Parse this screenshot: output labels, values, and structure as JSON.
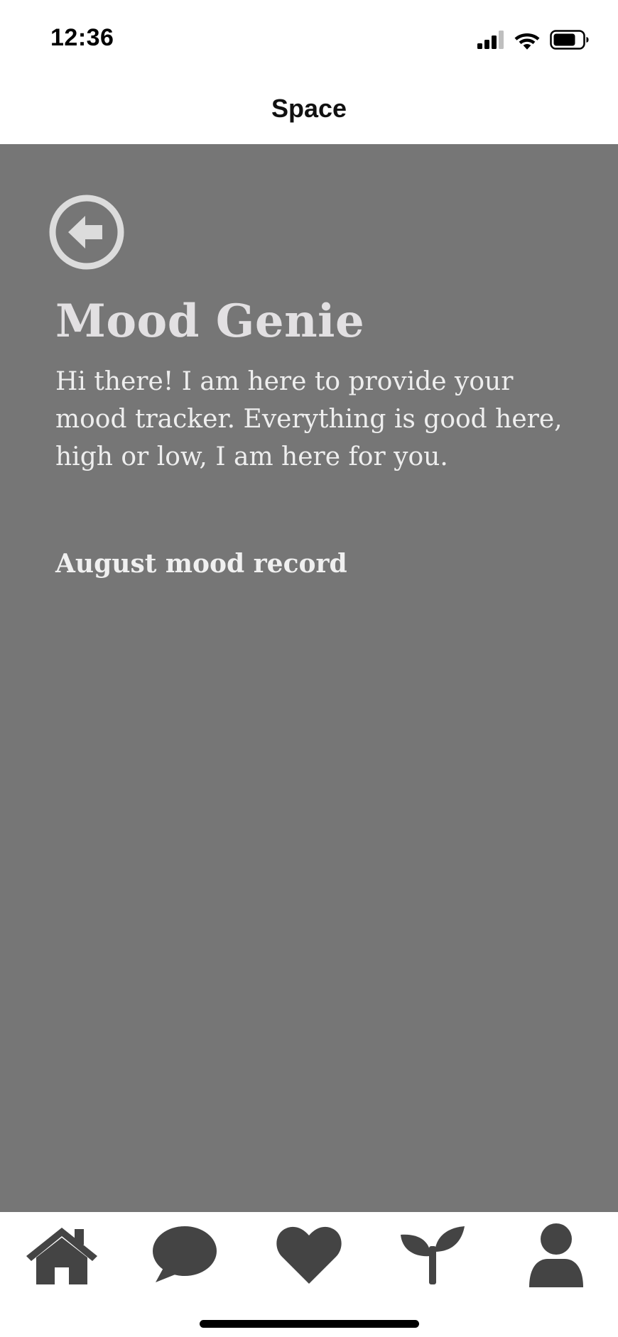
{
  "status_bar": {
    "time": "12:36",
    "icons": [
      "signal-icon",
      "wifi-icon",
      "battery-icon"
    ]
  },
  "nav": {
    "title": "Space"
  },
  "main": {
    "back_icon": "arrow-left-circle-icon",
    "title": "Mood Genie",
    "intro": "Hi there! I am here to provide your mood tracker. Everything is good here,  high or low, I am here for you.",
    "section_title": "August mood record",
    "background_color": "#767676"
  },
  "tab_bar": {
    "tabs": [
      {
        "icon": "home-icon"
      },
      {
        "icon": "chat-bubble-icon"
      },
      {
        "icon": "heart-icon"
      },
      {
        "icon": "sprout-icon"
      },
      {
        "icon": "user-icon"
      }
    ],
    "icon_color": "#444444"
  }
}
